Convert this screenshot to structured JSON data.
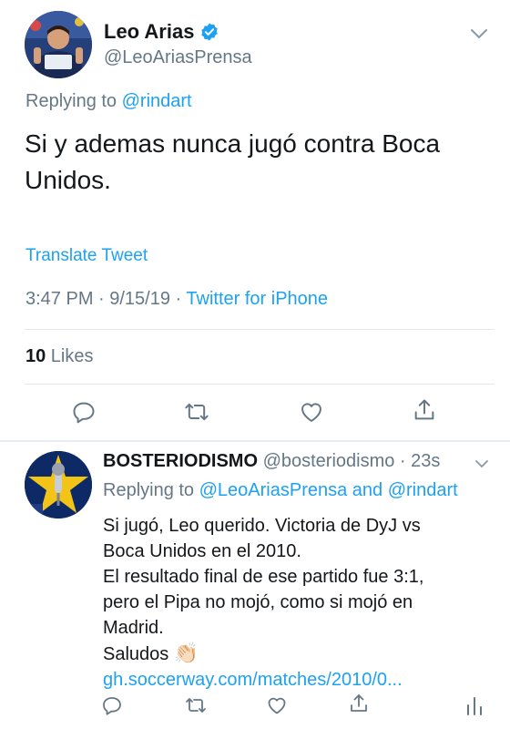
{
  "main_tweet": {
    "display_name": "Leo Arias",
    "handle": "@LeoAriasPrensa",
    "replying_prefix": "Replying to",
    "replying_to": "@rindart",
    "text": "Si y ademas nunca jugó contra Boca Unidos.",
    "translate": "Translate Tweet",
    "timestamp": "3:47 PM · 9/15/19 · ",
    "source": "Twitter for iPhone",
    "likes_count": "10",
    "likes_label": " Likes"
  },
  "reply_tweet": {
    "display_name": "BOSTERIODISMO",
    "handle": " @bosteriodismo · 23s",
    "replying_prefix": "Replying to ",
    "replying_to_1": "@LeoAriasPrensa",
    "replying_and": " and ",
    "replying_to_2": "@rindart",
    "lines": [
      "Si jugó, Leo querido. Victoria de DyJ vs",
      "Boca Unidos en el 2010.",
      "El resultado final de ese partido fue 3:1,",
      "pero el Pipa no mojó, como si mojó en",
      "Madrid."
    ],
    "closing": "Saludos ",
    "clap": "👏🏻",
    "link": "gh.soccerway.com/matches/2010/0..."
  },
  "colors": {
    "accent": "#1da1f2",
    "secondary_text": "#657786",
    "primary_text": "#14171a",
    "divider": "#e1e8ed"
  },
  "icons": [
    "verified-badge-icon",
    "chevron-down-icon",
    "reply-icon",
    "retweet-icon",
    "like-icon",
    "share-icon",
    "analytics-icon"
  ]
}
